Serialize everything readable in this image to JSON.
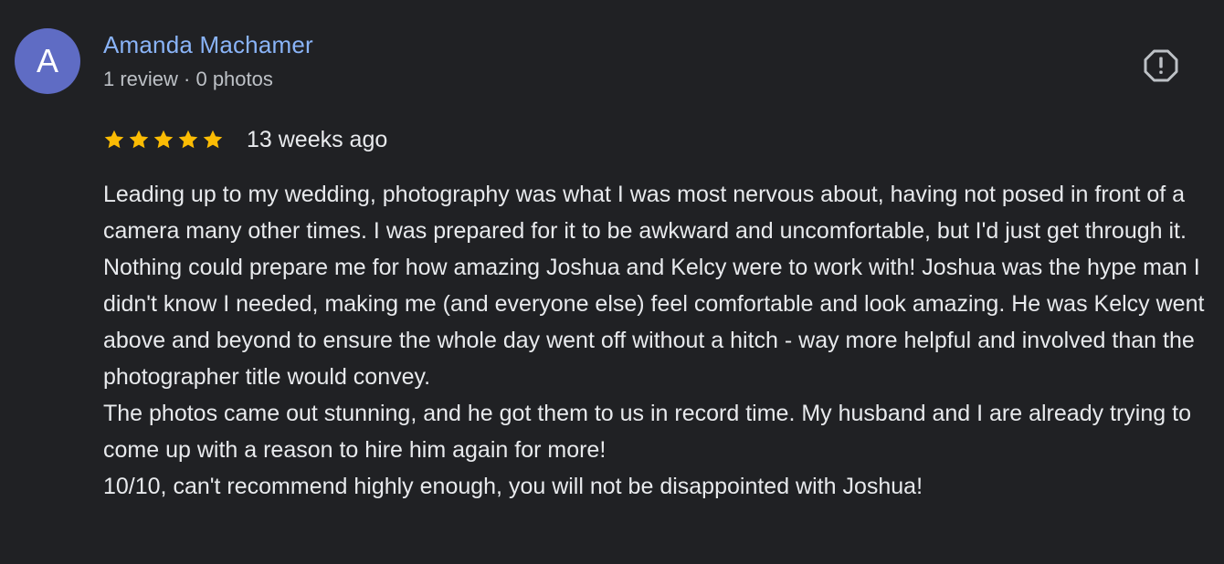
{
  "author": {
    "initial": "A",
    "name": "Amanda Machamer",
    "meta": "1 review · 0 photos",
    "avatar_color": "#5f6cc4"
  },
  "report_icon": "report-flag-icon",
  "rating": {
    "stars": 5,
    "max": 5,
    "star_color": "#fbbc04",
    "time": "13 weeks ago"
  },
  "review": {
    "paragraphs": [
      "Leading up to my wedding, photography was what I was most nervous about, having not posed in front of a camera many other times. I was prepared for it to be awkward and uncomfortable, but I'd just get through it.",
      "Nothing could prepare me for how amazing Joshua and Kelcy were to work with! Joshua was the hype man I didn't know I needed, making me (and everyone else) feel comfortable and look amazing. He was Kelcy went above and beyond to ensure the whole day went off without a hitch - way more helpful and involved than the photographer title would convey.",
      "The photos came out stunning, and he got them to us in record time. My husband and I are already trying to come up with a reason to hire him again for more!",
      "10/10, can't recommend highly enough, you will not be disappointed with Joshua!"
    ]
  },
  "colors": {
    "background": "#202124",
    "name": "#8ab4f8",
    "text": "#e8eaed",
    "meta": "#bdc1c6"
  }
}
